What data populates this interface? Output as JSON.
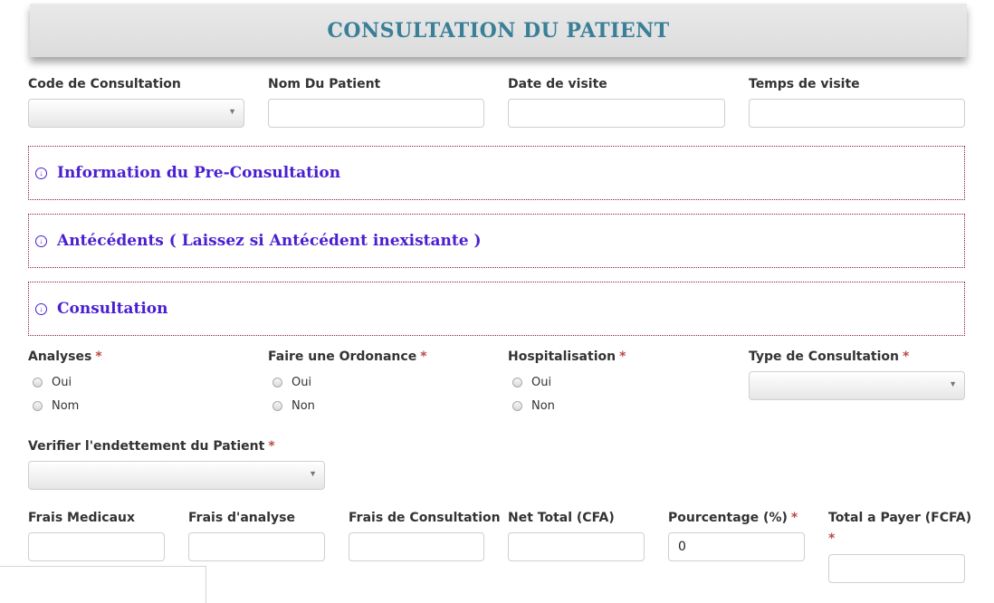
{
  "header": {
    "title": "CONSULTATION DU PATIENT"
  },
  "top_fields": {
    "code_label": "Code de Consultation",
    "nom_label": "Nom Du Patient",
    "date_label": "Date de visite",
    "temps_label": "Temps de visite",
    "code_value": "",
    "nom_value": "",
    "date_value": "",
    "temps_value": ""
  },
  "panels": [
    {
      "title": "Information du Pre-Consultation"
    },
    {
      "title": "Antécédents ( Laissez si Antécédent inexistante )"
    },
    {
      "title": "Consultation"
    }
  ],
  "consultation": {
    "analyses_label": "Analyses",
    "analyses_options": [
      "Oui",
      "Nom"
    ],
    "ordonance_label": "Faire une Ordonance",
    "ordonance_options": [
      "Oui",
      "Non"
    ],
    "hospitalisation_label": "Hospitalisation",
    "hospitalisation_options": [
      "Oui",
      "Non"
    ],
    "type_label": "Type de Consultation",
    "type_value": "",
    "required_mark": "*",
    "endettement_label": "Verifier l'endettement du Patient",
    "endettement_value": ""
  },
  "fees": {
    "frais_medicaux_label": "Frais Medicaux",
    "frais_analyse_label": "Frais d'analyse",
    "frais_consultation_label": "Frais de Consultation",
    "net_total_label": "Net Total (CFA)",
    "pourcentage_label": "Pourcentage (%)",
    "total_payer_label": "Total a Payer (FCFA)",
    "frais_medicaux_value": "",
    "frais_analyse_value": "",
    "frais_consultation_value": "",
    "net_total_value": "",
    "pourcentage_value": "0",
    "total_payer_value": ""
  },
  "icons": {
    "panel_toggle": "circle-arrow-down-icon",
    "select_arrow": "caret-down-icon"
  },
  "colors": {
    "header_title": "#3a7f98",
    "panel_title": "#4a1fd1",
    "panel_border": "#8b1a4a",
    "required": "#b94a48"
  }
}
